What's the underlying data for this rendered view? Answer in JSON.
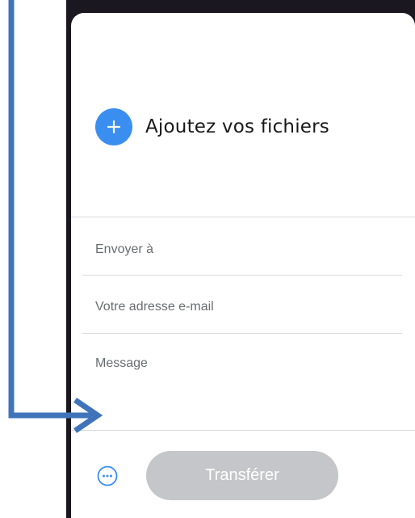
{
  "upload": {
    "add_files_label": "Ajoutez vos fichiers",
    "add_icon": "plus-icon",
    "accent_color": "#3a8ef0"
  },
  "form": {
    "send_to_placeholder": "Envoyer à",
    "email_placeholder": "Votre adresse e-mail",
    "message_placeholder": "Message"
  },
  "footer": {
    "options_icon": "more-options-icon",
    "transfer_label": "Transférer",
    "transfer_enabled": false
  },
  "annotation": {
    "arrow_color": "#3f74ba"
  }
}
